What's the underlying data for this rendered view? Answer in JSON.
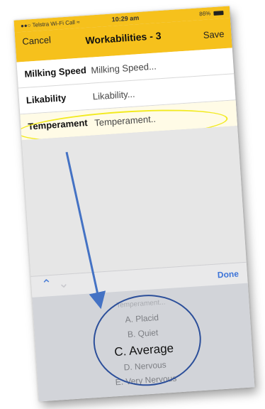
{
  "status_bar": {
    "carrier": "Telstra Wi-Fi Call",
    "time": "10:29 am",
    "battery": "86%"
  },
  "nav": {
    "cancel": "Cancel",
    "title": "Workabilities - 3",
    "save": "Save"
  },
  "rows": [
    {
      "label": "Milking Speed",
      "value": "Milking Speed..."
    },
    {
      "label": "Likability",
      "value": "Likability..."
    },
    {
      "label": "Temperament",
      "value": "Temperament.."
    }
  ],
  "accessory": {
    "done": "Done"
  },
  "picker": {
    "options": [
      "Temperament...",
      "A. Placid",
      "B. Quiet",
      "C. Average",
      "D. Nervous",
      "E. Very Nervous"
    ],
    "selected": "C. Average"
  },
  "colors": {
    "nav_bg": "#f6c11c",
    "highlight_ellipse": "#f2ea1f",
    "annotation_blue": "#4472c4",
    "accent": "#3d74d8"
  },
  "icons": [
    "wifi-icon",
    "signal-icon",
    "battery-icon",
    "chevron-up-icon",
    "chevron-down-icon"
  ]
}
